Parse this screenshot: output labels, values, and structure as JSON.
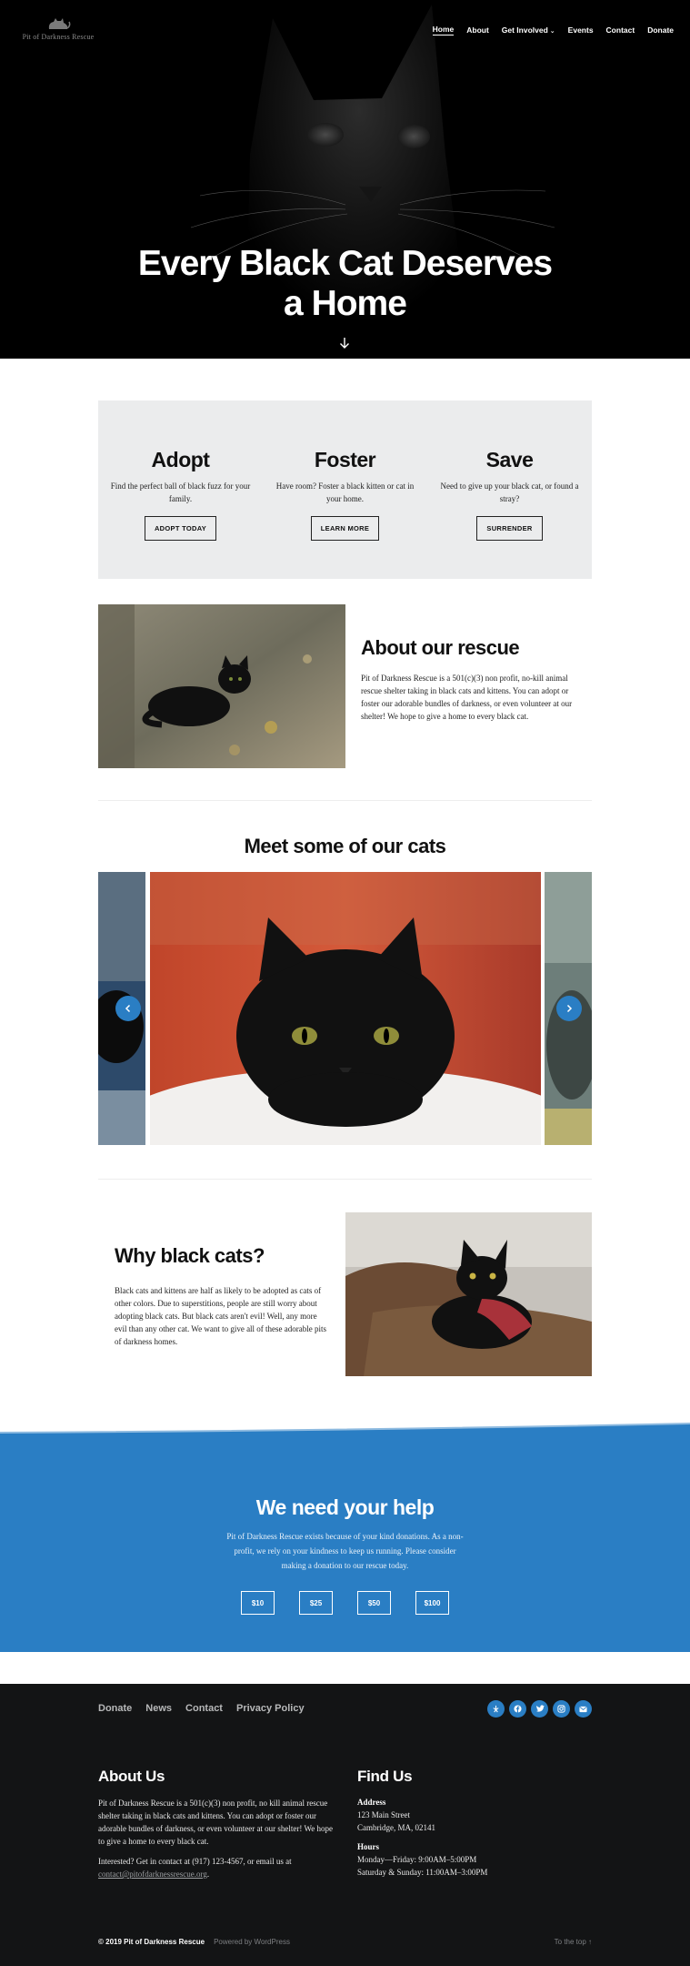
{
  "header": {
    "logo_text": "Pit of Darkness Rescue",
    "nav": [
      {
        "label": "Home",
        "active": true
      },
      {
        "label": "About"
      },
      {
        "label": "Get Involved",
        "dropdown": true
      },
      {
        "label": "Events"
      },
      {
        "label": "Contact"
      },
      {
        "label": "Donate"
      }
    ]
  },
  "hero": {
    "title_line1": "Every Black Cat Deserves",
    "title_line2": "a Home",
    "arrow_icon": "arrow-down-icon"
  },
  "services": [
    {
      "title": "Adopt",
      "text": "Find the perfect ball of black fuzz for your family.",
      "button": "ADOPT TODAY"
    },
    {
      "title": "Foster",
      "text": "Have room? Foster a black kitten or cat in your home.",
      "button": "LEARN MORE"
    },
    {
      "title": "Save",
      "text": "Need to give up your black cat, or found a stray?",
      "button": "SURRENDER"
    }
  ],
  "about": {
    "title": "About our rescue",
    "text": "Pit of Darkness Rescue is a 501(c)(3) non profit, no-kill animal rescue shelter taking in black cats and kittens. You can adopt or foster our adorable bundles of darkness, or even volunteer at our shelter! We hope to give a home to every black cat."
  },
  "cats": {
    "title": "Meet some of our cats",
    "prev_icon": "chevron-left-icon",
    "next_icon": "chevron-right-icon"
  },
  "why": {
    "title": "Why black cats?",
    "text": "Black cats and kittens are half as likely to be adopted as cats of other colors. Due to superstitions, people are still worry about adopting black cats. But black cats aren't evil! Well, any more evil than any other cat. We want to give all of these adorable pits of darkness homes."
  },
  "help": {
    "title": "We need your help",
    "text": "Pit of Darkness Rescue exists because of your kind donations. As a non-profit, we rely on your kindness to keep us running. Please consider making a donation to our rescue today.",
    "amounts": [
      "$10",
      "$25",
      "$50",
      "$100"
    ],
    "bg_color": "#2a7ec4"
  },
  "footer": {
    "nav": [
      "Donate",
      "News",
      "Contact",
      "Privacy Policy"
    ],
    "social_icons": [
      "yelp-icon",
      "facebook-icon",
      "twitter-icon",
      "instagram-icon",
      "email-icon"
    ],
    "about_title": "About Us",
    "about_text": "Pit of Darkness Rescue is a 501(c)(3) non profit, no kill animal rescue shelter taking in black cats and kittens. You can adopt or foster our adorable bundles of darkness, or even volunteer at our shelter! We hope to give a home to every black cat.",
    "contact_text": "Interested? Get in contact at (917) 123-4567, or email us at",
    "contact_email": "contact@pitofdarknessrescue.org",
    "contact_end": ".",
    "find_title": "Find Us",
    "address_label": "Address",
    "address_line1": "123 Main Street",
    "address_line2": "Cambridge, MA, 02141",
    "hours_label": "Hours",
    "hours_line1": "Monday—Friday: 9:00AM–5:00PM",
    "hours_line2": "Saturday & Sunday: 11:00AM–3:00PM",
    "copyright": "© 2019 Pit of Darkness Rescue",
    "powered": "Powered by WordPress",
    "to_top": "To the top ↑"
  }
}
